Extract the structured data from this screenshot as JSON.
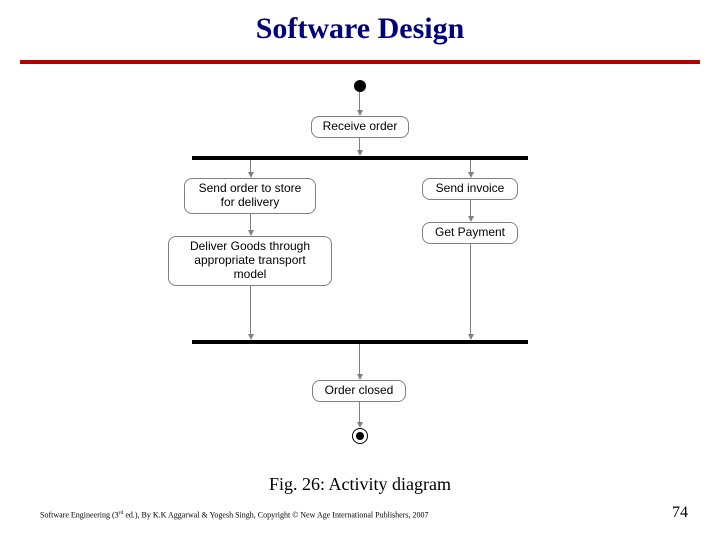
{
  "title": "Software Design",
  "caption": "Fig. 26: Activity diagram",
  "credit_pre": "Software Engineering (3",
  "credit_sup": "rd",
  "credit_post": " ed.), By K.K Aggarwal & Yogesh Singh, Copyright © New Age International Publishers, 2007",
  "page_number": "74",
  "diagram": {
    "type": "uml-activity",
    "initial": true,
    "final": true,
    "activities": {
      "receive": "Receive order",
      "send_store": "Send order to store for delivery",
      "deliver": "Deliver Goods through appropriate transport model",
      "invoice": "Send invoice",
      "payment": "Get Payment",
      "closed": "Order closed"
    },
    "bars": [
      "fork",
      "join"
    ],
    "edges": [
      [
        "initial",
        "receive"
      ],
      [
        "receive",
        "fork"
      ],
      [
        "fork",
        "send_store"
      ],
      [
        "fork",
        "invoice"
      ],
      [
        "send_store",
        "deliver"
      ],
      [
        "invoice",
        "payment"
      ],
      [
        "deliver",
        "join"
      ],
      [
        "payment",
        "join"
      ],
      [
        "join",
        "closed"
      ],
      [
        "closed",
        "final"
      ]
    ]
  }
}
